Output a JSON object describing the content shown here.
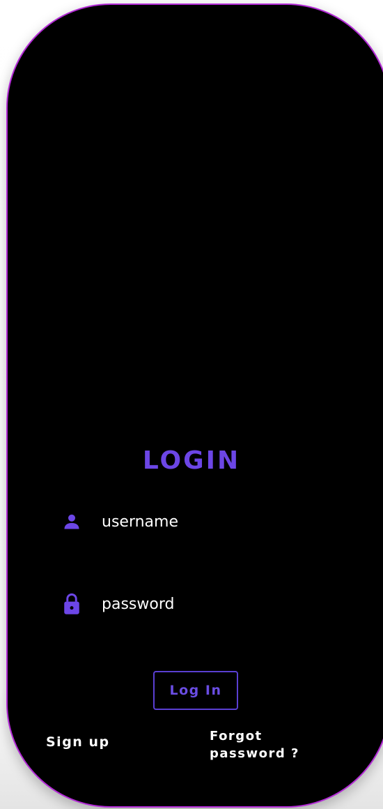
{
  "login_form": {
    "title": "LOGIN",
    "username": {
      "icon": "person-icon",
      "placeholder": "username",
      "value": ""
    },
    "password": {
      "icon": "lock-icon",
      "placeholder": "password",
      "value": ""
    },
    "login_button_label": "Log In",
    "signup_label": "Sign up",
    "forgot_password_label": "Forgot password ?"
  },
  "colors": {
    "card_background": "#000000",
    "card_border": "#b32ad6",
    "accent": "#6c46e6",
    "text": "#ffffff"
  }
}
